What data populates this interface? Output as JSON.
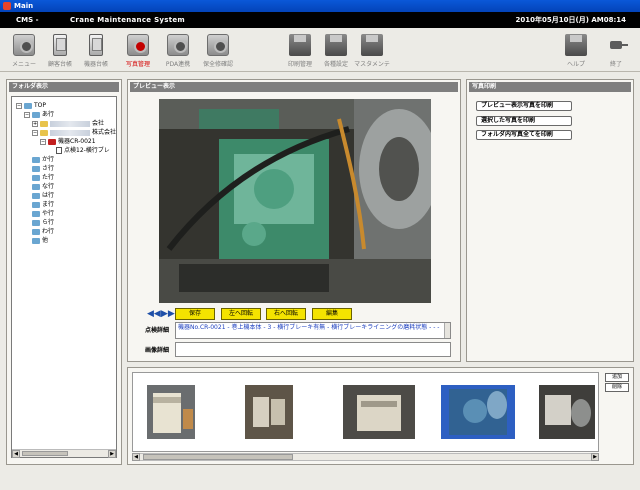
{
  "window": {
    "title": "Main"
  },
  "header": {
    "app_name": "CMS -",
    "system_name": "Crane Maintenance System",
    "datetime": "2010年05月10日(月) AM08:14"
  },
  "toolbar": {
    "left": [
      {
        "label": "メニュー",
        "icon": "camera-icon",
        "active": false
      },
      {
        "label": "顧客台帳",
        "icon": "device-icon",
        "active": false
      },
      {
        "label": "機器台帳",
        "icon": "device-icon",
        "active": false
      },
      {
        "label": "写真管理",
        "icon": "camera-icon",
        "active": true
      },
      {
        "label": "PDA連携",
        "icon": "camera-icon",
        "active": false
      },
      {
        "label": "保全修確認",
        "icon": "camera-icon",
        "active": false
      }
    ],
    "middle": [
      {
        "label": "印刷管理",
        "icon": "disk-icon"
      },
      {
        "label": "各種設定",
        "icon": "disk-icon"
      },
      {
        "label": "マスタメンテ",
        "icon": "disk-icon"
      }
    ],
    "right": [
      {
        "label": "ヘルプ",
        "icon": "disk-icon"
      },
      {
        "label": "終了",
        "icon": "plug-icon"
      }
    ]
  },
  "folder_panel": {
    "title": "フォルダ表示",
    "tree": {
      "root": "TOP",
      "a_row": "あ行",
      "company1_suffix": "会社",
      "company2_suffix": "株式会社",
      "device": "機器CR-0021",
      "inspection": "点検12-横行ブレ",
      "rows": [
        "か行",
        "さ行",
        "た行",
        "な行",
        "は行",
        "ま行",
        "や行",
        "ら行",
        "わ行",
        "他"
      ]
    }
  },
  "preview_panel": {
    "title": "プレビュー表示",
    "buttons": {
      "save": "保存",
      "rotate_left": "左へ回転",
      "rotate_right": "右へ回転",
      "edit": "編集"
    },
    "inspection_label": "点検詳細",
    "inspection_text": "機器No.CR-0021 - 巻上機本体 - 3 - 横行ブレーキ有無 - 横行ブレーキライニングの磨耗状態 - - -",
    "image_label": "画像詳細",
    "image_text": ""
  },
  "print_panel": {
    "title": "写真印刷",
    "buttons": [
      "プレビュー表示写真を印刷",
      "選択した写真を印刷",
      "フォルダ内写真全てを印刷"
    ]
  },
  "thumbnail_panel": {
    "add_label": "追加",
    "delete_label": "削除",
    "selected_index": 3,
    "count": 5
  },
  "colors": {
    "title_blue": "#0a58d8",
    "accent_yellow": "#f4e300",
    "selected_blue": "#2d5fc2",
    "active_label_red": "#d40000"
  }
}
